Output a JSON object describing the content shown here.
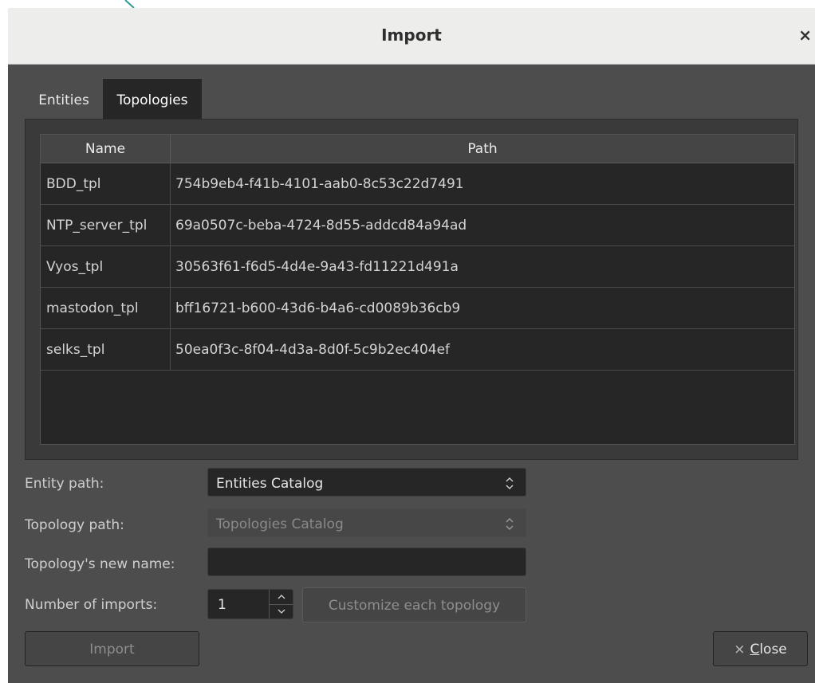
{
  "window": {
    "title": "Import",
    "close_glyph": "×",
    "close_icon": "close-icon"
  },
  "tabs": [
    {
      "label": "Entities",
      "selected": false
    },
    {
      "label": "Topologies",
      "selected": true
    }
  ],
  "table": {
    "columns": [
      "Name",
      "Path"
    ],
    "rows": [
      {
        "name": "BDD_tpl",
        "path": "754b9eb4-f41b-4101-aab0-8c53c22d7491"
      },
      {
        "name": "NTP_server_tpl",
        "path": "69a0507c-beba-4724-8d55-addcd84a94ad"
      },
      {
        "name": "Vyos_tpl",
        "path": "30563f61-f6d5-4d4e-9a43-fd11221d491a"
      },
      {
        "name": "mastodon_tpl",
        "path": "bff16721-b600-43d6-b4a6-cd0089b36cb9"
      },
      {
        "name": "selks_tpl",
        "path": "50ea0f3c-8f04-4d3a-8d0f-5c9b2ec404ef"
      }
    ]
  },
  "form": {
    "entity_path_label": "Entity path:",
    "entity_path_value": "Entities Catalog",
    "topology_path_label": "Topology path:",
    "topology_path_value": "Topologies Catalog",
    "new_name_label": "Topology's new name:",
    "new_name_value": "",
    "num_imports_label": "Number of imports:",
    "num_imports_value": "1",
    "customize_label": "Customize each topology",
    "select_chevron": "⌃⌄"
  },
  "footer": {
    "import_label": "Import",
    "close_label": "Close",
    "close_mnemonic": "C",
    "close_rest": "lose",
    "close_glyph": "×"
  },
  "colors": {
    "dialog_bg": "#4d4d4d",
    "titlebar_bg": "#ededeb",
    "table_bg": "#262626",
    "accent_line": "#2e9b8f"
  }
}
